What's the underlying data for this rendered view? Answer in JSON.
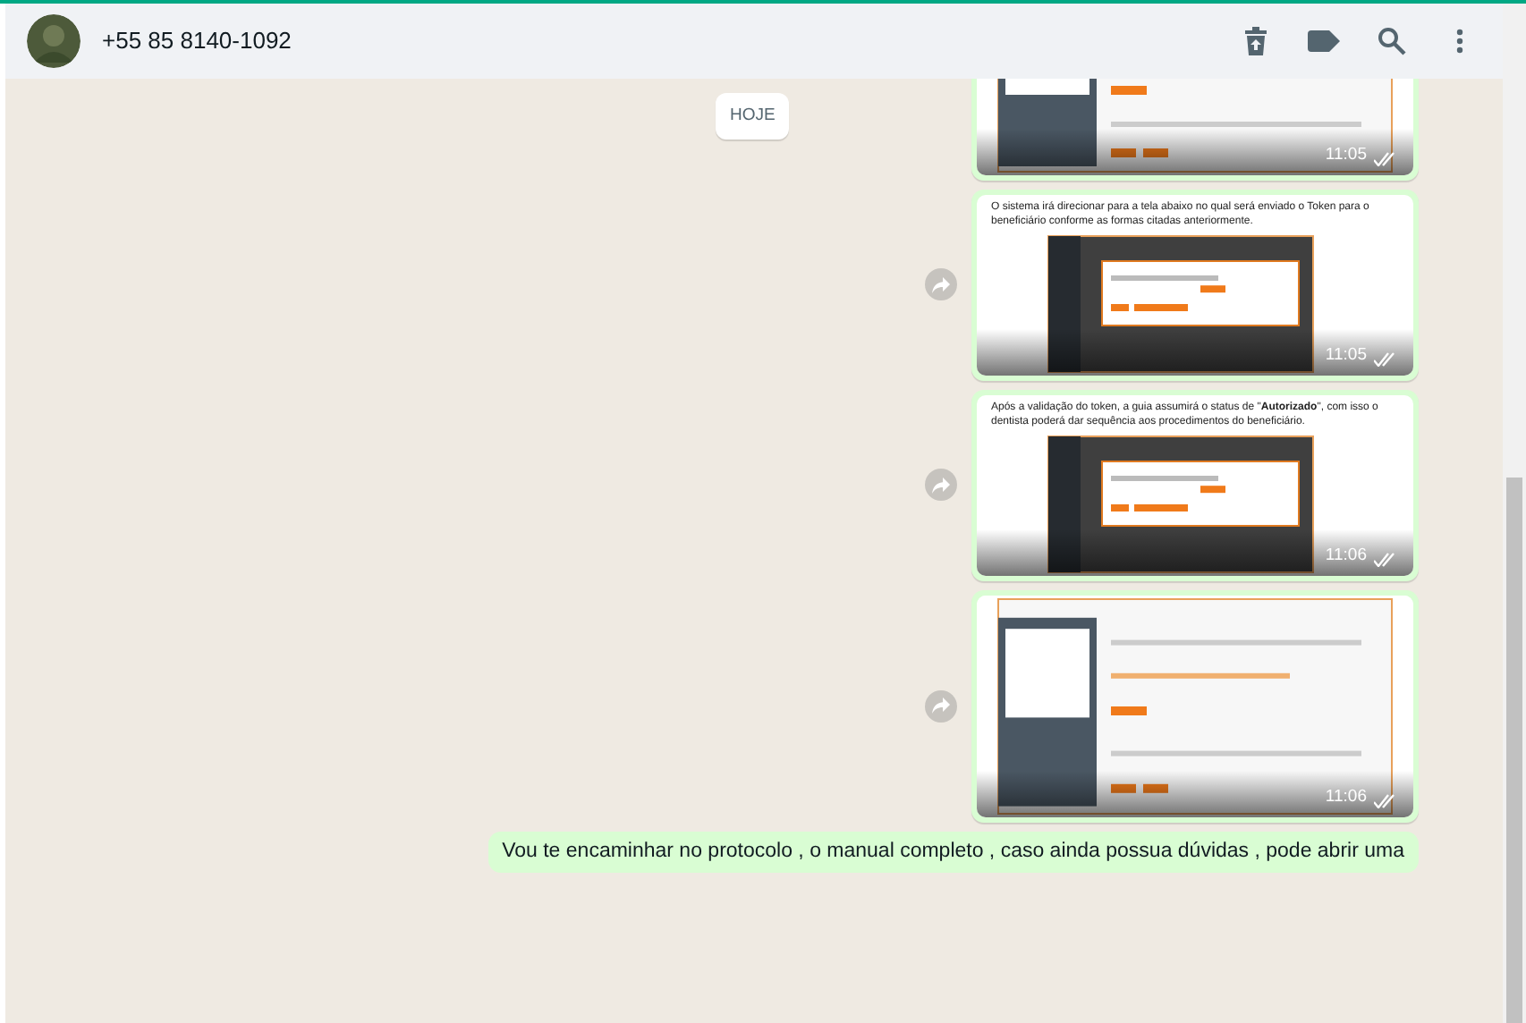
{
  "header": {
    "contact": "+55 85 8140-1092"
  },
  "date_chip": "HOJE",
  "messages": [
    {
      "time": "11:05",
      "forward": false
    },
    {
      "caption": "O sistema irá direcionar para a tela abaixo no qual será enviado o Token para o beneficiário conforme as formas citadas anteriormente.",
      "time": "11:05",
      "forward": true
    },
    {
      "caption": "Após a validação do token, a guia assumirá o status de \"**Autorizado**\", com isso o dentista poderá dar sequência aos procedimentos do beneficiário.",
      "time": "11:06",
      "forward": true
    },
    {
      "time": "11:06",
      "forward": true
    },
    {
      "kind": "text",
      "text": "Vou te encaminhar no protocolo , o manual completo , caso ainda possua dúvidas , pode abrir uma"
    }
  ]
}
